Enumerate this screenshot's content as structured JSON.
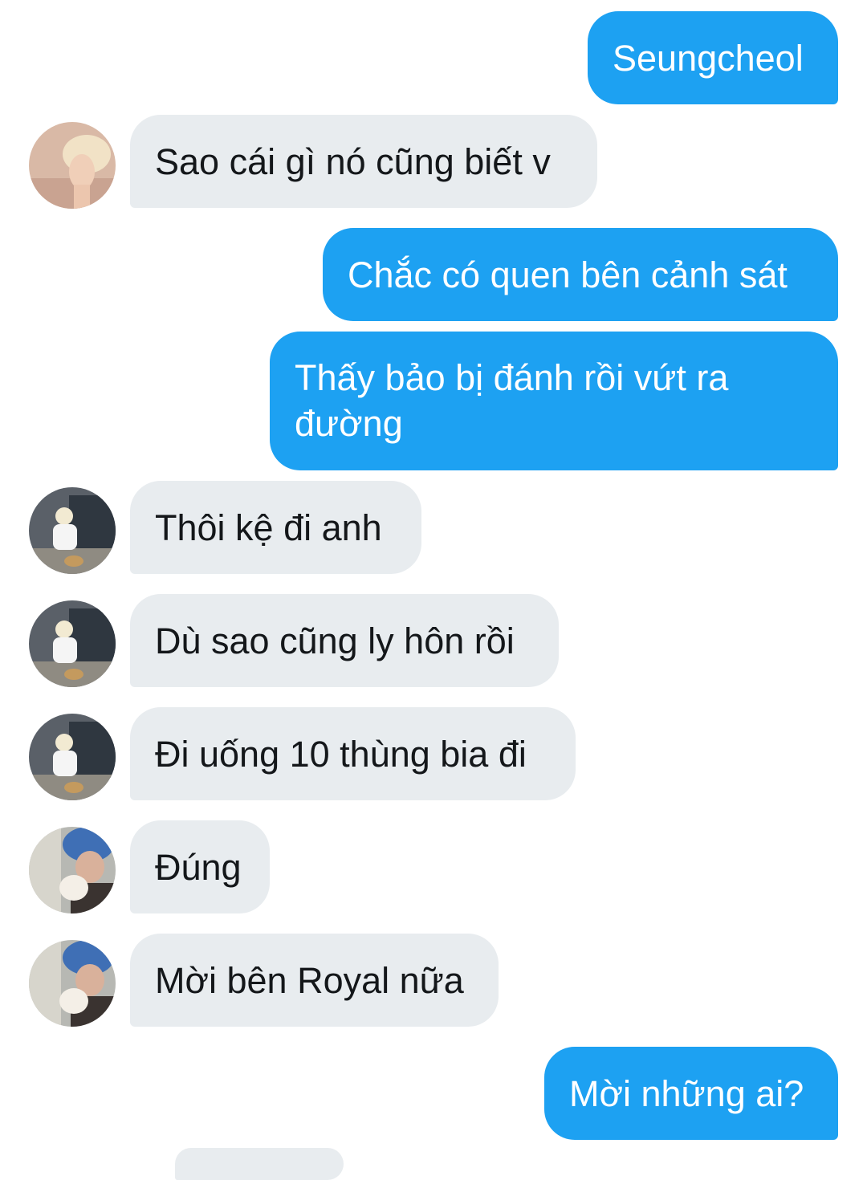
{
  "conversation": {
    "messages": [
      {
        "sender": "me",
        "text": "Seungcheol"
      },
      {
        "sender": "other",
        "avatar": "blonde-profile-avatar",
        "text": "Sao cái gì nó cũng biết v"
      },
      {
        "sender": "me",
        "text": "Chắc có quen bên cảnh sát"
      },
      {
        "sender": "me",
        "text": "Thấy bảo bị đánh rồi vứt ra đường"
      },
      {
        "sender": "other",
        "avatar": "car-dog-avatar",
        "text": "Thôi kệ đi anh"
      },
      {
        "sender": "other",
        "avatar": "car-dog-avatar",
        "text": "Dù sao cũng ly hôn rồi"
      },
      {
        "sender": "other",
        "avatar": "car-dog-avatar",
        "text": "Đi uống 10 thùng bia đi"
      },
      {
        "sender": "other",
        "avatar": "blue-hair-puppy-avatar",
        "text": "Đúng"
      },
      {
        "sender": "other",
        "avatar": "blue-hair-puppy-avatar",
        "text": "Mời bên Royal nữa"
      },
      {
        "sender": "me",
        "text": "Mời những ai?"
      }
    ]
  },
  "colors": {
    "outgoing_bubble": "#1da1f2",
    "incoming_bubble": "#e8ecef",
    "incoming_text": "#14171a",
    "outgoing_text": "#ffffff"
  }
}
